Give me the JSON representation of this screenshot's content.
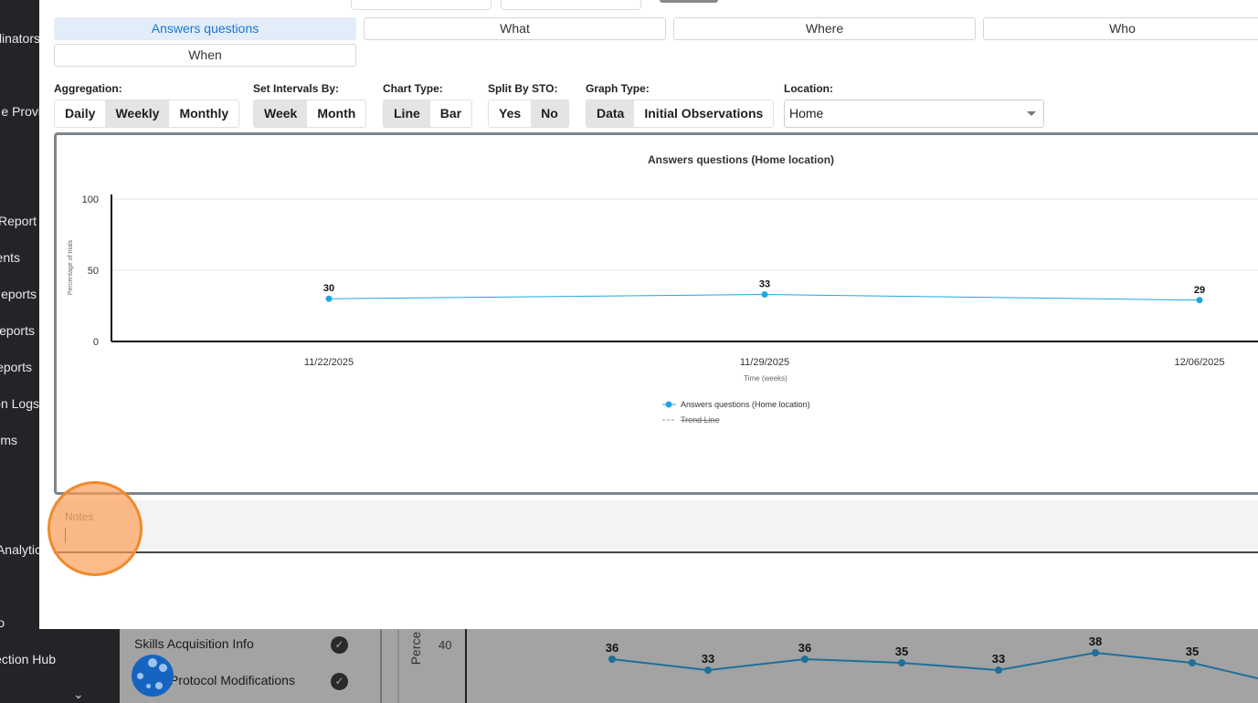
{
  "sidebar": {
    "items": [
      "dinators",
      "e Provi",
      "Report",
      "ents",
      "eports",
      "eports",
      "eports",
      "on Logs",
      "ms",
      "Analytic",
      "o",
      "ection Hub"
    ]
  },
  "background": {
    "panel_rows": [
      "Skills Acquisition Info",
      "Protocol Modifications"
    ],
    "bg_chart": {
      "ylabel": "Perce",
      "ytick": "40",
      "values": [
        36,
        33,
        36,
        35,
        33,
        38,
        35
      ]
    }
  },
  "tabs": [
    {
      "label": "Answers questions",
      "active": true
    },
    {
      "label": "What",
      "active": false
    },
    {
      "label": "Where",
      "active": false
    },
    {
      "label": "Who",
      "active": false
    },
    {
      "label": "When",
      "active": false
    }
  ],
  "controls": {
    "aggregation": {
      "label": "Aggregation:",
      "options": [
        "Daily",
        "Weekly",
        "Monthly"
      ],
      "selected": "Weekly"
    },
    "intervals": {
      "label": "Set Intervals By:",
      "options": [
        "Week",
        "Month"
      ],
      "selected": "Week"
    },
    "chart_type": {
      "label": "Chart Type:",
      "options": [
        "Line",
        "Bar"
      ],
      "selected": "Line"
    },
    "split_sto": {
      "label": "Split By STO:",
      "options": [
        "Yes",
        "No"
      ],
      "selected": "No"
    },
    "graph_type": {
      "label": "Graph Type:",
      "options": [
        "Data",
        "Initial Observations"
      ],
      "selected": "Data"
    },
    "location": {
      "label": "Location:",
      "value": "Home"
    }
  },
  "chart_data": {
    "type": "line",
    "title": "Answers questions (Home location)",
    "xlabel": "Time (weeks)",
    "ylabel": "Percentage of trials",
    "categories": [
      "11/22/2025",
      "11/29/2025",
      "12/06/2025"
    ],
    "series": [
      {
        "name": "Answers questions (Home location)",
        "values": [
          30,
          33,
          29
        ],
        "color": "#1ea7e1"
      }
    ],
    "legend_extra": "Trend Line",
    "yticks": [
      "0",
      "50",
      "100"
    ],
    "ylim": [
      0,
      100
    ],
    "grid": true,
    "legend_position": "bottom"
  },
  "notes": {
    "label": "Notes",
    "value": ""
  }
}
